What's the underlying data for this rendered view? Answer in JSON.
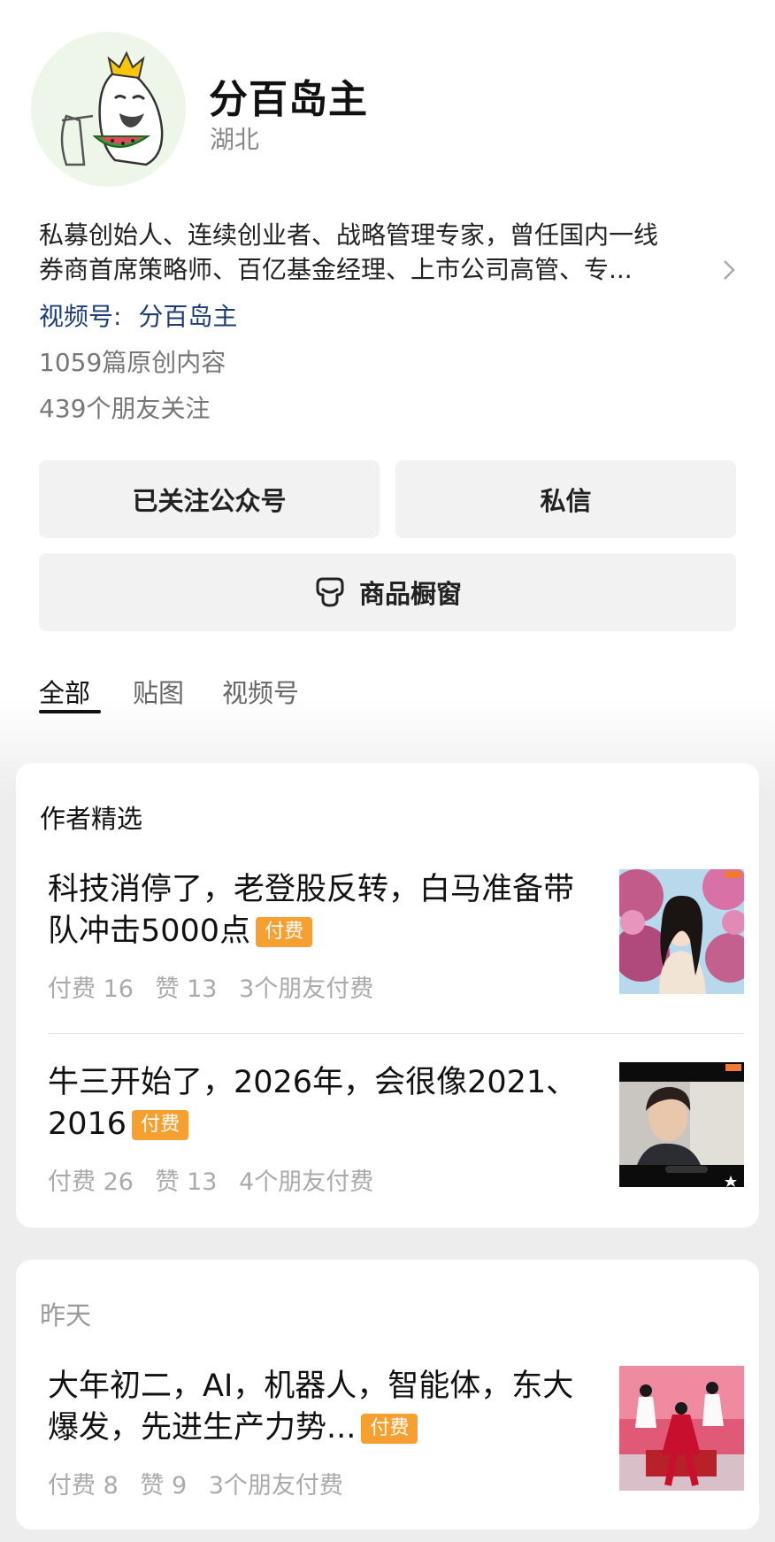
{
  "profile": {
    "name": "分百岛主",
    "region": "湖北",
    "bio_line1": "私募创始人、连续创业者、战略管理专家，曾任国内一线",
    "bio_line2": "券商首席策略师、百亿基金经理、上市公司高管、专...",
    "channel_label": "视频号:",
    "channel_name": "分百岛主",
    "original_count": "1059篇原创内容",
    "friends_following": "439个朋友关注"
  },
  "actions": {
    "followed_label": "已关注公众号",
    "message_label": "私信",
    "shop_label": "商品橱窗"
  },
  "tabs": [
    {
      "label": "全部",
      "active": true
    },
    {
      "label": "贴图",
      "active": false
    },
    {
      "label": "视频号",
      "active": false
    }
  ],
  "featured": {
    "title": "作者精选",
    "articles": [
      {
        "title": "科技消停了，老登股反转，白马准备带队冲击5000点",
        "badge": "付费",
        "paid": "付费 16",
        "likes": "赞 13",
        "friends": "3个朋友付费"
      },
      {
        "title": "牛三开始了，2026年，会很像2021、2016",
        "badge": "付费",
        "paid": "付费 26",
        "likes": "赞 13",
        "friends": "4个朋友付费"
      }
    ]
  },
  "yesterday": {
    "title": "昨天",
    "articles": [
      {
        "title": "大年初二，AI，机器人，智能体，东大爆发，先进生产力势...",
        "badge": "付费",
        "paid": "付费 8",
        "likes": "赞 9",
        "friends": "3个朋友付费"
      }
    ]
  },
  "colors": {
    "badge": "#f5a030",
    "channel_link": "#1f3c7a",
    "button_bg": "#f2f2f2"
  }
}
